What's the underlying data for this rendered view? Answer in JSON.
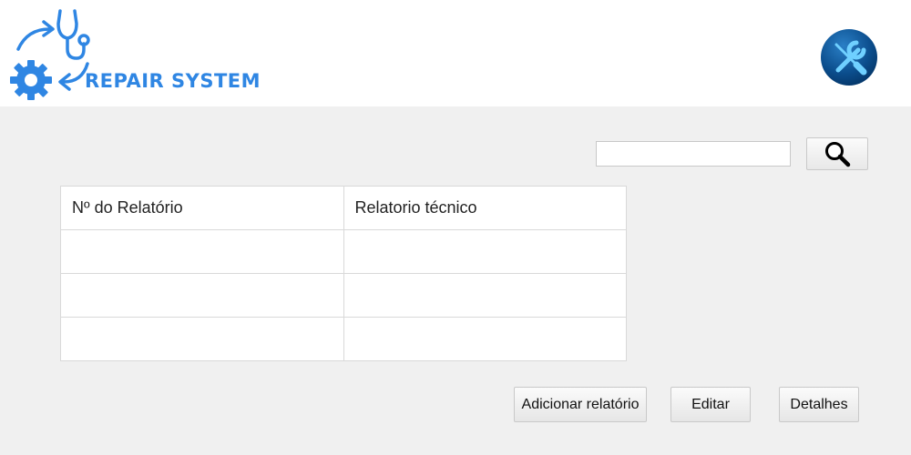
{
  "header": {
    "logo_text": "REPAIR SYSTEM",
    "brand_color": "#2f86e3",
    "badge_icon": "wrench-screwdriver-icon"
  },
  "search": {
    "value": "",
    "button_icon": "magnifier-icon"
  },
  "table": {
    "columns": [
      "Nº do Relatório",
      "Relatorio técnico"
    ],
    "rows": [
      [
        "",
        ""
      ],
      [
        "",
        ""
      ],
      [
        "",
        ""
      ]
    ]
  },
  "actions": {
    "add_label": "Adicionar relatório",
    "edit_label": "Editar",
    "details_label": "Detalhes"
  }
}
